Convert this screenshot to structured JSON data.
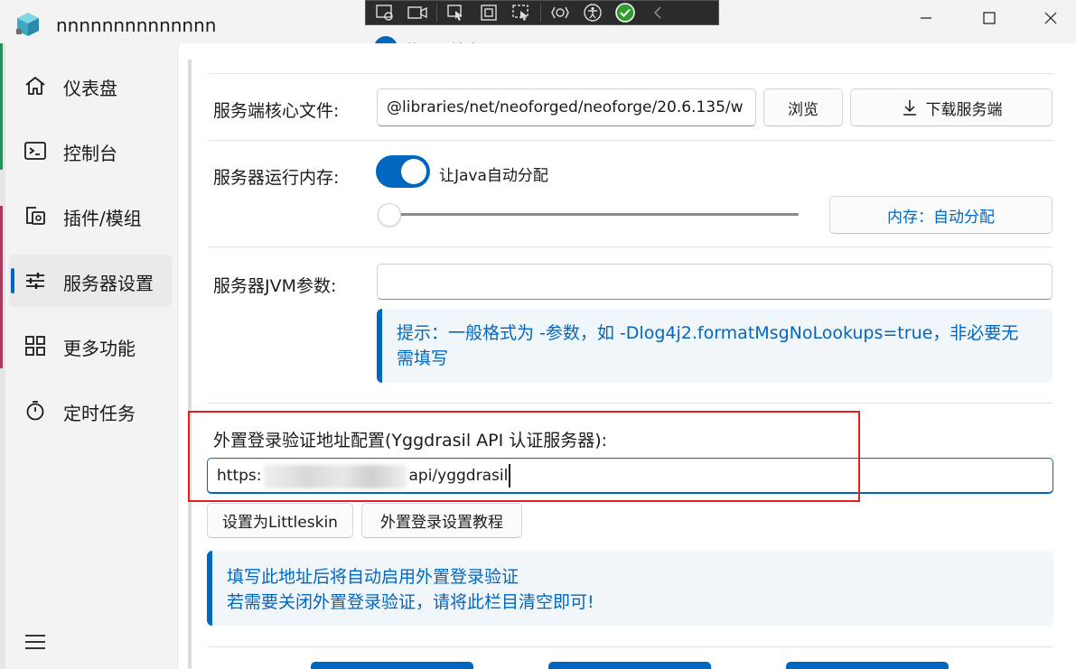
{
  "window": {
    "title": "nnnnnnnnnnnnnn"
  },
  "capture_toolbar": {
    "tools": [
      "screen-record-icon",
      "camera-icon",
      "pointer-icon",
      "region-icon",
      "select-region-icon",
      "accessibility-icon",
      "person-icon",
      "check-icon",
      "chevron-left-icon"
    ]
  },
  "sidebar": {
    "items": [
      {
        "label": "仪表盘",
        "icon": "home-icon"
      },
      {
        "label": "控制台",
        "icon": "terminal-icon"
      },
      {
        "label": "插件/模组",
        "icon": "plugins-icon"
      },
      {
        "label": "服务器设置",
        "icon": "sliders-icon",
        "active": true
      },
      {
        "label": "更多功能",
        "icon": "grid-icon"
      },
      {
        "label": "定时任务",
        "icon": "timer-icon"
      }
    ],
    "menu_icon": "hamburger-icon"
  },
  "settings": {
    "clipped_option": "使用环境变量",
    "core_file": {
      "label": "服务端核心文件:",
      "value": "@libraries/net/neoforged/neoforge/20.6.135/w",
      "browse_label": "浏览",
      "download_label": "下载服务端"
    },
    "memory": {
      "label": "服务器运行内存:",
      "toggle_label": "让Java自动分配",
      "toggle_on": true,
      "slider_level": 0,
      "button_label": "内存：自动分配"
    },
    "jvm": {
      "label": "服务器JVM参数:",
      "value": "",
      "hint": "提示：一般格式为 -参数，如 -Dlog4j2.formatMsgNoLookups=true，非必要无需填写"
    },
    "auth": {
      "label": "外置登录验证地址配置(Yggdrasil API 认证服务器):",
      "value_prefix": "https:",
      "value_suffix": "api/yggdrasil",
      "littleskin_label": "设置为Littleskin",
      "tutorial_label": "外置登录设置教程",
      "info_line1": "填写此地址后将自动启用外置登录验证",
      "info_line2": "若需要关闭外置登录验证，请将此栏目清空即可!"
    }
  },
  "colors": {
    "accent": "#0067c0",
    "highlight": "#e02020",
    "info_bg": "#f1f6fb"
  }
}
